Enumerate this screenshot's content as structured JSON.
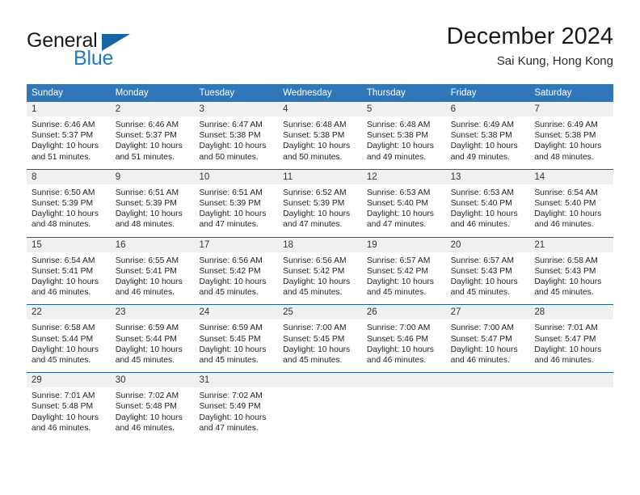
{
  "logo": {
    "word_top": "General",
    "word_bottom": "Blue",
    "accent_color": "#1565a8",
    "blue_text_color": "#1f7ac4"
  },
  "header": {
    "title": "December 2024",
    "subtitle": "Sai Kung, Hong Kong"
  },
  "theme": {
    "header_row_bg": "#2f77b8",
    "week_divider": "#1f5fa0",
    "day_number_bg": "#f0f0f0"
  },
  "calendar": {
    "weekdays": [
      "Sunday",
      "Monday",
      "Tuesday",
      "Wednesday",
      "Thursday",
      "Friday",
      "Saturday"
    ],
    "weeks": [
      [
        {
          "day": "1",
          "sunrise": "Sunrise: 6:46 AM",
          "sunset": "Sunset: 5:37 PM",
          "daylight_line1": "Daylight: 10 hours",
          "daylight_line2": "and 51 minutes."
        },
        {
          "day": "2",
          "sunrise": "Sunrise: 6:46 AM",
          "sunset": "Sunset: 5:37 PM",
          "daylight_line1": "Daylight: 10 hours",
          "daylight_line2": "and 51 minutes."
        },
        {
          "day": "3",
          "sunrise": "Sunrise: 6:47 AM",
          "sunset": "Sunset: 5:38 PM",
          "daylight_line1": "Daylight: 10 hours",
          "daylight_line2": "and 50 minutes."
        },
        {
          "day": "4",
          "sunrise": "Sunrise: 6:48 AM",
          "sunset": "Sunset: 5:38 PM",
          "daylight_line1": "Daylight: 10 hours",
          "daylight_line2": "and 50 minutes."
        },
        {
          "day": "5",
          "sunrise": "Sunrise: 6:48 AM",
          "sunset": "Sunset: 5:38 PM",
          "daylight_line1": "Daylight: 10 hours",
          "daylight_line2": "and 49 minutes."
        },
        {
          "day": "6",
          "sunrise": "Sunrise: 6:49 AM",
          "sunset": "Sunset: 5:38 PM",
          "daylight_line1": "Daylight: 10 hours",
          "daylight_line2": "and 49 minutes."
        },
        {
          "day": "7",
          "sunrise": "Sunrise: 6:49 AM",
          "sunset": "Sunset: 5:38 PM",
          "daylight_line1": "Daylight: 10 hours",
          "daylight_line2": "and 48 minutes."
        }
      ],
      [
        {
          "day": "8",
          "sunrise": "Sunrise: 6:50 AM",
          "sunset": "Sunset: 5:39 PM",
          "daylight_line1": "Daylight: 10 hours",
          "daylight_line2": "and 48 minutes."
        },
        {
          "day": "9",
          "sunrise": "Sunrise: 6:51 AM",
          "sunset": "Sunset: 5:39 PM",
          "daylight_line1": "Daylight: 10 hours",
          "daylight_line2": "and 48 minutes."
        },
        {
          "day": "10",
          "sunrise": "Sunrise: 6:51 AM",
          "sunset": "Sunset: 5:39 PM",
          "daylight_line1": "Daylight: 10 hours",
          "daylight_line2": "and 47 minutes."
        },
        {
          "day": "11",
          "sunrise": "Sunrise: 6:52 AM",
          "sunset": "Sunset: 5:39 PM",
          "daylight_line1": "Daylight: 10 hours",
          "daylight_line2": "and 47 minutes."
        },
        {
          "day": "12",
          "sunrise": "Sunrise: 6:53 AM",
          "sunset": "Sunset: 5:40 PM",
          "daylight_line1": "Daylight: 10 hours",
          "daylight_line2": "and 47 minutes."
        },
        {
          "day": "13",
          "sunrise": "Sunrise: 6:53 AM",
          "sunset": "Sunset: 5:40 PM",
          "daylight_line1": "Daylight: 10 hours",
          "daylight_line2": "and 46 minutes."
        },
        {
          "day": "14",
          "sunrise": "Sunrise: 6:54 AM",
          "sunset": "Sunset: 5:40 PM",
          "daylight_line1": "Daylight: 10 hours",
          "daylight_line2": "and 46 minutes."
        }
      ],
      [
        {
          "day": "15",
          "sunrise": "Sunrise: 6:54 AM",
          "sunset": "Sunset: 5:41 PM",
          "daylight_line1": "Daylight: 10 hours",
          "daylight_line2": "and 46 minutes."
        },
        {
          "day": "16",
          "sunrise": "Sunrise: 6:55 AM",
          "sunset": "Sunset: 5:41 PM",
          "daylight_line1": "Daylight: 10 hours",
          "daylight_line2": "and 46 minutes."
        },
        {
          "day": "17",
          "sunrise": "Sunrise: 6:56 AM",
          "sunset": "Sunset: 5:42 PM",
          "daylight_line1": "Daylight: 10 hours",
          "daylight_line2": "and 45 minutes."
        },
        {
          "day": "18",
          "sunrise": "Sunrise: 6:56 AM",
          "sunset": "Sunset: 5:42 PM",
          "daylight_line1": "Daylight: 10 hours",
          "daylight_line2": "and 45 minutes."
        },
        {
          "day": "19",
          "sunrise": "Sunrise: 6:57 AM",
          "sunset": "Sunset: 5:42 PM",
          "daylight_line1": "Daylight: 10 hours",
          "daylight_line2": "and 45 minutes."
        },
        {
          "day": "20",
          "sunrise": "Sunrise: 6:57 AM",
          "sunset": "Sunset: 5:43 PM",
          "daylight_line1": "Daylight: 10 hours",
          "daylight_line2": "and 45 minutes."
        },
        {
          "day": "21",
          "sunrise": "Sunrise: 6:58 AM",
          "sunset": "Sunset: 5:43 PM",
          "daylight_line1": "Daylight: 10 hours",
          "daylight_line2": "and 45 minutes."
        }
      ],
      [
        {
          "day": "22",
          "sunrise": "Sunrise: 6:58 AM",
          "sunset": "Sunset: 5:44 PM",
          "daylight_line1": "Daylight: 10 hours",
          "daylight_line2": "and 45 minutes."
        },
        {
          "day": "23",
          "sunrise": "Sunrise: 6:59 AM",
          "sunset": "Sunset: 5:44 PM",
          "daylight_line1": "Daylight: 10 hours",
          "daylight_line2": "and 45 minutes."
        },
        {
          "day": "24",
          "sunrise": "Sunrise: 6:59 AM",
          "sunset": "Sunset: 5:45 PM",
          "daylight_line1": "Daylight: 10 hours",
          "daylight_line2": "and 45 minutes."
        },
        {
          "day": "25",
          "sunrise": "Sunrise: 7:00 AM",
          "sunset": "Sunset: 5:45 PM",
          "daylight_line1": "Daylight: 10 hours",
          "daylight_line2": "and 45 minutes."
        },
        {
          "day": "26",
          "sunrise": "Sunrise: 7:00 AM",
          "sunset": "Sunset: 5:46 PM",
          "daylight_line1": "Daylight: 10 hours",
          "daylight_line2": "and 46 minutes."
        },
        {
          "day": "27",
          "sunrise": "Sunrise: 7:00 AM",
          "sunset": "Sunset: 5:47 PM",
          "daylight_line1": "Daylight: 10 hours",
          "daylight_line2": "and 46 minutes."
        },
        {
          "day": "28",
          "sunrise": "Sunrise: 7:01 AM",
          "sunset": "Sunset: 5:47 PM",
          "daylight_line1": "Daylight: 10 hours",
          "daylight_line2": "and 46 minutes."
        }
      ],
      [
        {
          "day": "29",
          "sunrise": "Sunrise: 7:01 AM",
          "sunset": "Sunset: 5:48 PM",
          "daylight_line1": "Daylight: 10 hours",
          "daylight_line2": "and 46 minutes."
        },
        {
          "day": "30",
          "sunrise": "Sunrise: 7:02 AM",
          "sunset": "Sunset: 5:48 PM",
          "daylight_line1": "Daylight: 10 hours",
          "daylight_line2": "and 46 minutes."
        },
        {
          "day": "31",
          "sunrise": "Sunrise: 7:02 AM",
          "sunset": "Sunset: 5:49 PM",
          "daylight_line1": "Daylight: 10 hours",
          "daylight_line2": "and 47 minutes."
        },
        {
          "day": "",
          "sunrise": "",
          "sunset": "",
          "daylight_line1": "",
          "daylight_line2": ""
        },
        {
          "day": "",
          "sunrise": "",
          "sunset": "",
          "daylight_line1": "",
          "daylight_line2": ""
        },
        {
          "day": "",
          "sunrise": "",
          "sunset": "",
          "daylight_line1": "",
          "daylight_line2": ""
        },
        {
          "day": "",
          "sunrise": "",
          "sunset": "",
          "daylight_line1": "",
          "daylight_line2": ""
        }
      ]
    ]
  }
}
